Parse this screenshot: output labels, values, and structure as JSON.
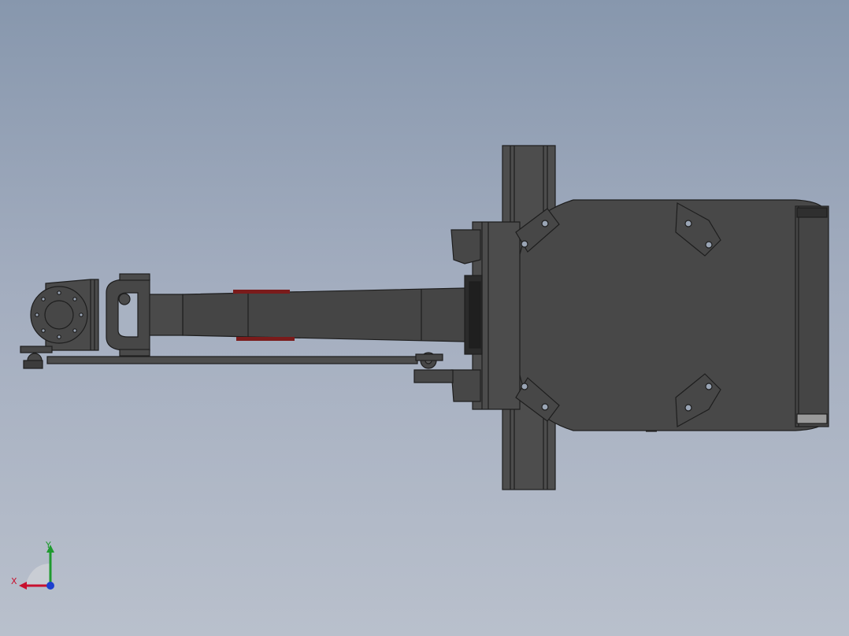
{
  "viewport": {
    "background_top": "#8797ad",
    "background_bottom": "#b9c0cc",
    "part_color": "#4a4a4a",
    "edge_color": "#1e1e1e",
    "hole_color": "#9aa5b5",
    "accent_color": "#7a1b1b"
  },
  "model": {
    "subject": "robot-arm-assembly"
  },
  "triad": {
    "x_label": "X",
    "y_label": "Y",
    "x_color": "#c8102e",
    "y_color": "#1f9a2f",
    "z_color": "#1d3fcf"
  }
}
